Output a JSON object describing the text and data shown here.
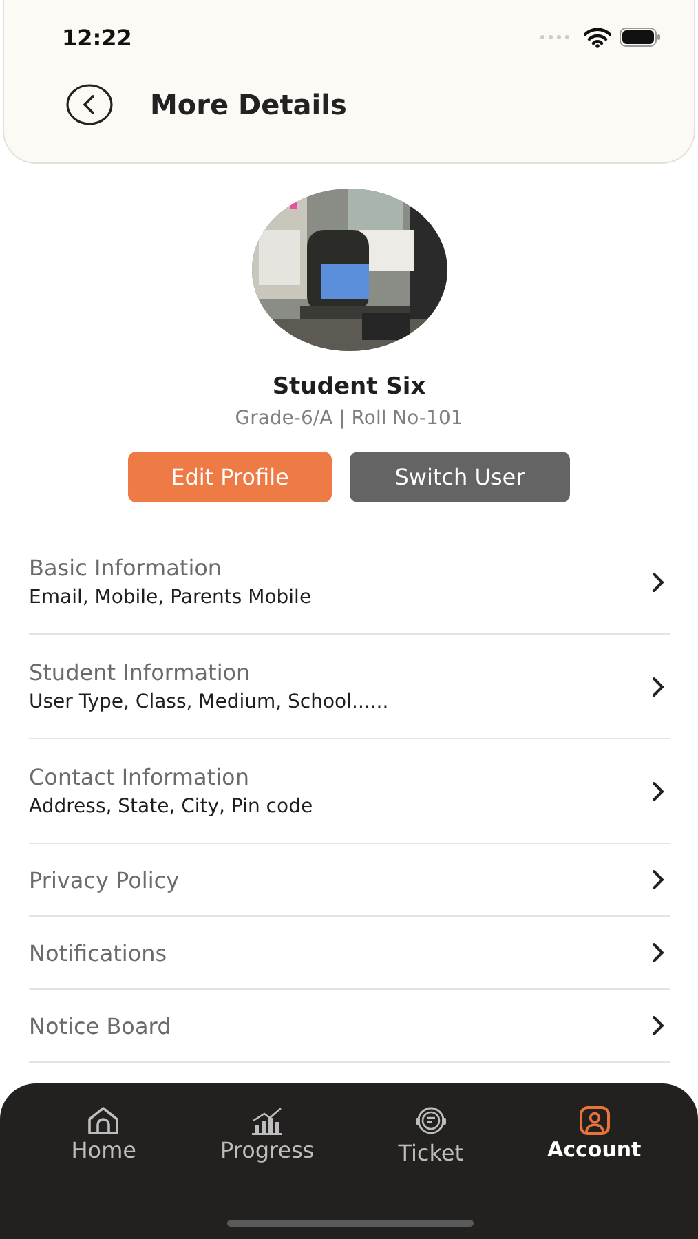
{
  "status_bar": {
    "time": "12:22"
  },
  "header": {
    "title": "More Details"
  },
  "profile": {
    "name": "Student Six",
    "subtitle": "Grade-6/A | Roll No-101"
  },
  "actions": [
    {
      "label": "Edit Profile",
      "kind": "primary"
    },
    {
      "label": "Switch User",
      "kind": "secondary"
    }
  ],
  "menu": [
    {
      "title": "Basic Information",
      "subtitle": "Email, Mobile, Parents Mobile"
    },
    {
      "title": "Student Information",
      "subtitle": "User Type, Class, Medium, School......"
    },
    {
      "title": "Contact Information",
      "subtitle": "Address, State, City, Pin code"
    },
    {
      "title": "Privacy Policy"
    },
    {
      "title": "Notifications"
    },
    {
      "title": "Notice Board"
    }
  ],
  "tab_bar": [
    {
      "label": "Home",
      "kind": "home",
      "selected": false
    },
    {
      "label": "Progress",
      "kind": "progress",
      "selected": false
    },
    {
      "label": "Ticket",
      "kind": "ticket",
      "selected": false
    },
    {
      "label": "Account",
      "kind": "account",
      "selected": true
    }
  ]
}
